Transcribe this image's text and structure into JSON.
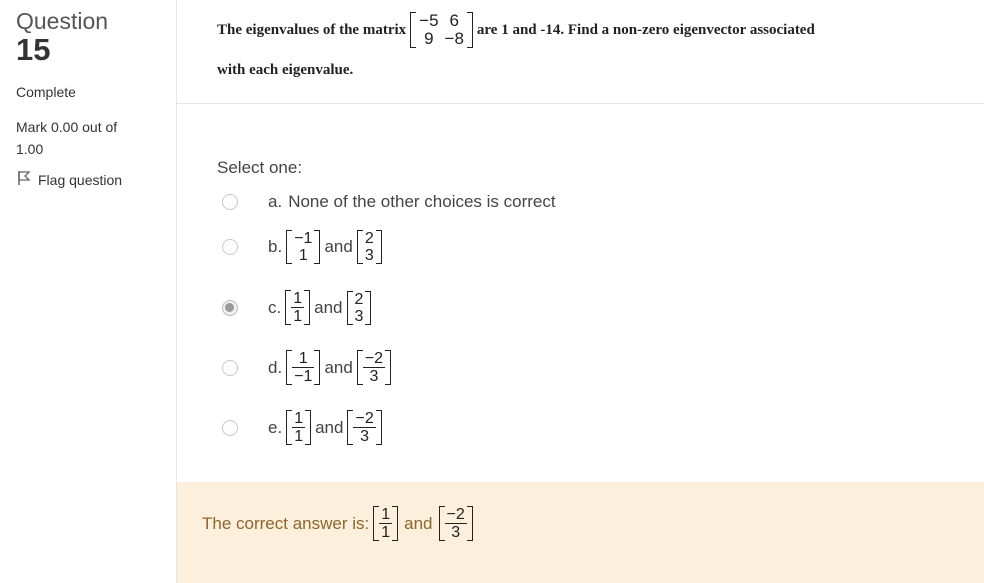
{
  "info": {
    "question_label": "Question",
    "question_number": "15",
    "state": "Complete",
    "grade_line1": "Mark 0.00 out of",
    "grade_line2": "1.00",
    "flag_label": "Flag question"
  },
  "question": {
    "text_before": "The eigenvalues of the matrix",
    "matrix": [
      [
        "−5",
        "6"
      ],
      [
        "9",
        "−8"
      ]
    ],
    "text_after": "are 1 and -14. Find a non-zero eigenvector associated",
    "text_line2": "with each eigenvalue."
  },
  "prompt": "Select one:",
  "options": [
    {
      "letter": "a.",
      "text": "None of the other choices is correct",
      "selected": false
    },
    {
      "letter": "b.",
      "v1": [
        "−1",
        "1"
      ],
      "and": "and",
      "v2": [
        "2",
        "3"
      ],
      "selected": false
    },
    {
      "letter": "c.",
      "v1": [
        "1",
        "1"
      ],
      "and": "and",
      "v2": [
        "2",
        "3"
      ],
      "selected": true
    },
    {
      "letter": "d.",
      "v1": [
        "1",
        "−1"
      ],
      "and": "and",
      "v2": [
        "−2",
        "3"
      ],
      "selected": false
    },
    {
      "letter": "e.",
      "v1": [
        "1",
        "1"
      ],
      "and": "and",
      "v2": [
        "−2",
        "3"
      ],
      "selected": false
    }
  ],
  "feedback": {
    "text": "The correct answer is:",
    "v1": [
      "1",
      "1"
    ],
    "and": "and",
    "v2": [
      "−2",
      "3"
    ]
  },
  "colors": {
    "feedback_bg": "#fcefdc",
    "feedback_text": "#8e662e"
  }
}
